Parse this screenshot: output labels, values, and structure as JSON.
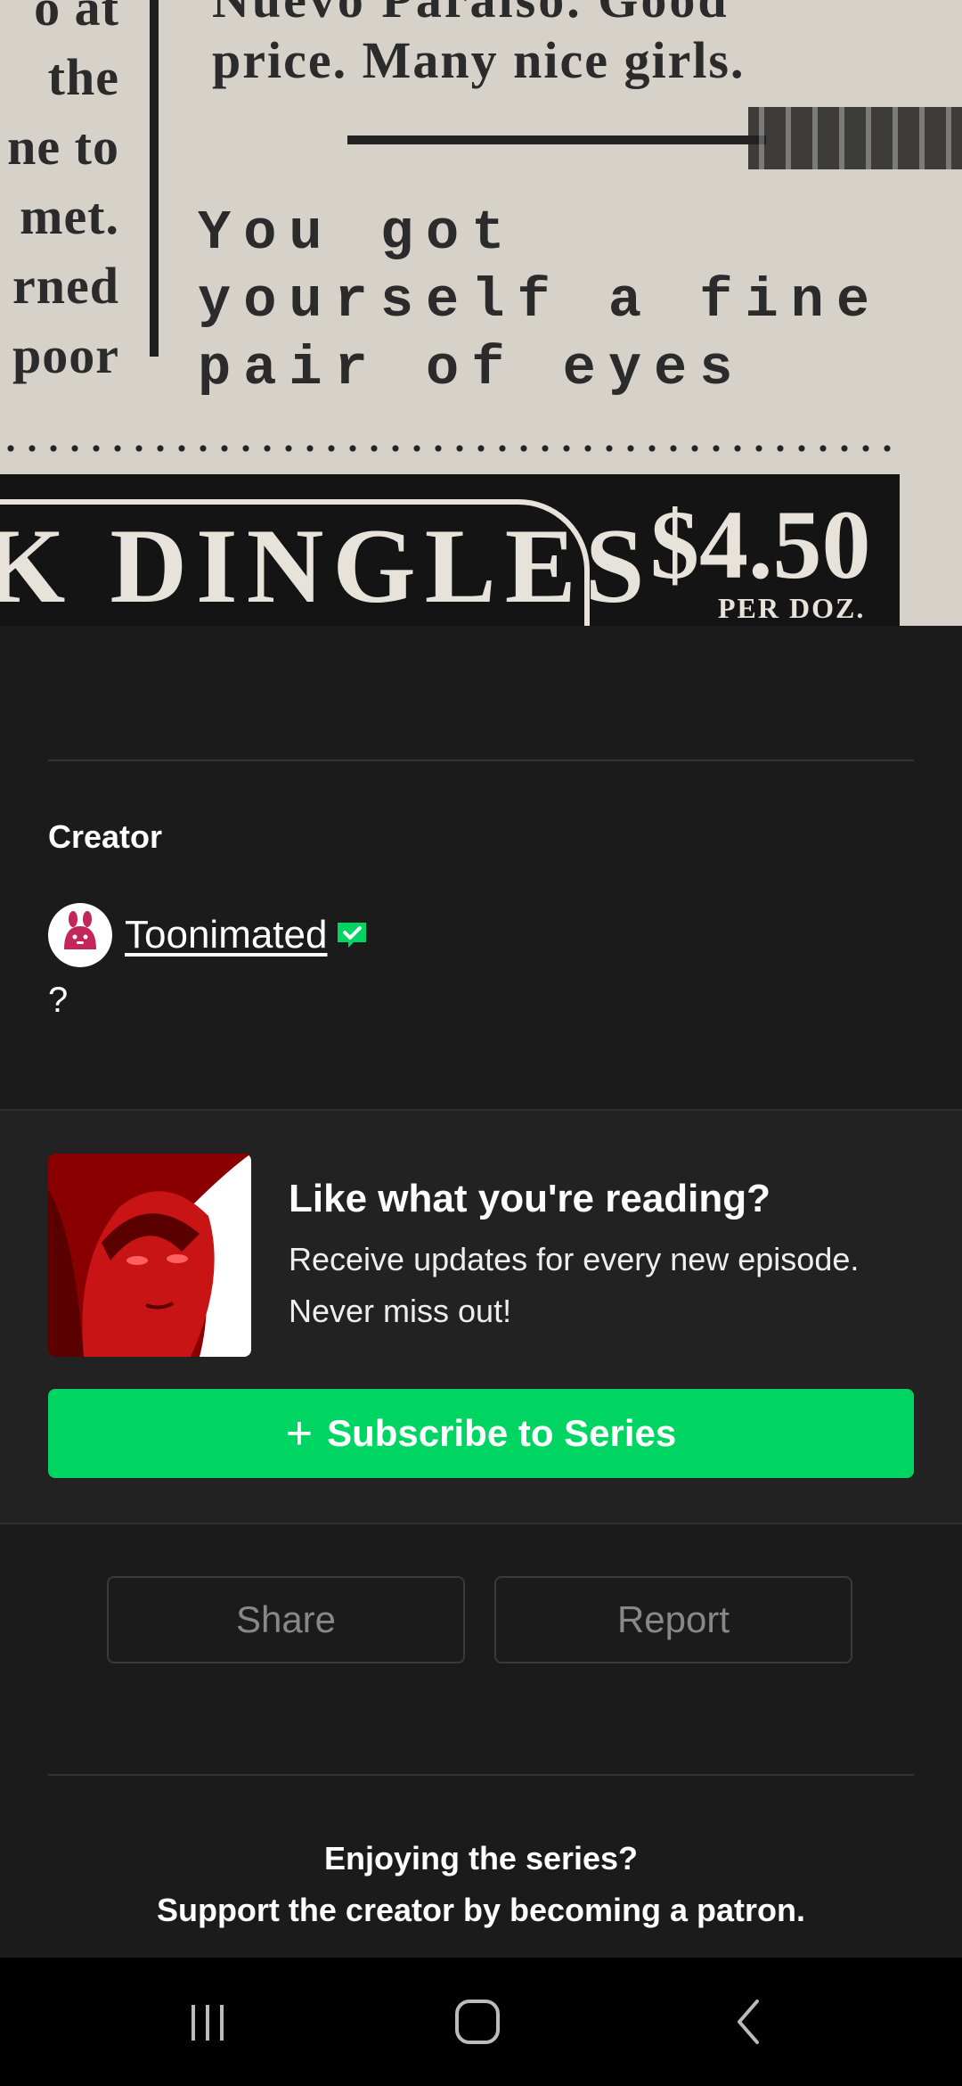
{
  "comic": {
    "left_column": [
      "o at",
      "the",
      "ne to",
      "met.",
      "rned",
      "poor"
    ],
    "top_line": "Nuevo Paraiso. Good",
    "second_line": "price. Many nice girls.",
    "mono_text": "You got yourself a fine pair of eyes",
    "ad_title": "K DINGLES",
    "ad_price": "$4.50",
    "ad_per": "PER DOZ."
  },
  "creator": {
    "section_title": "Creator",
    "name": "Toonimated",
    "bio": "?",
    "verified_icon": "verified-check-icon",
    "verified_color": "#00d564"
  },
  "promo": {
    "title": "Like what you're reading?",
    "body_line1": "Receive updates for every new episode.",
    "body_line2": "Never miss out!",
    "subscribe_label": "Subscribe to Series",
    "accent": "#00d564"
  },
  "actions": {
    "share_label": "Share",
    "report_label": "Report"
  },
  "patron": {
    "line1": "Enjoying the series?",
    "line2": "Support the creator by becoming a patron."
  },
  "navbar": {
    "recent_icon": "recent-apps-icon",
    "home_icon": "home-icon",
    "back_icon": "back-icon"
  }
}
